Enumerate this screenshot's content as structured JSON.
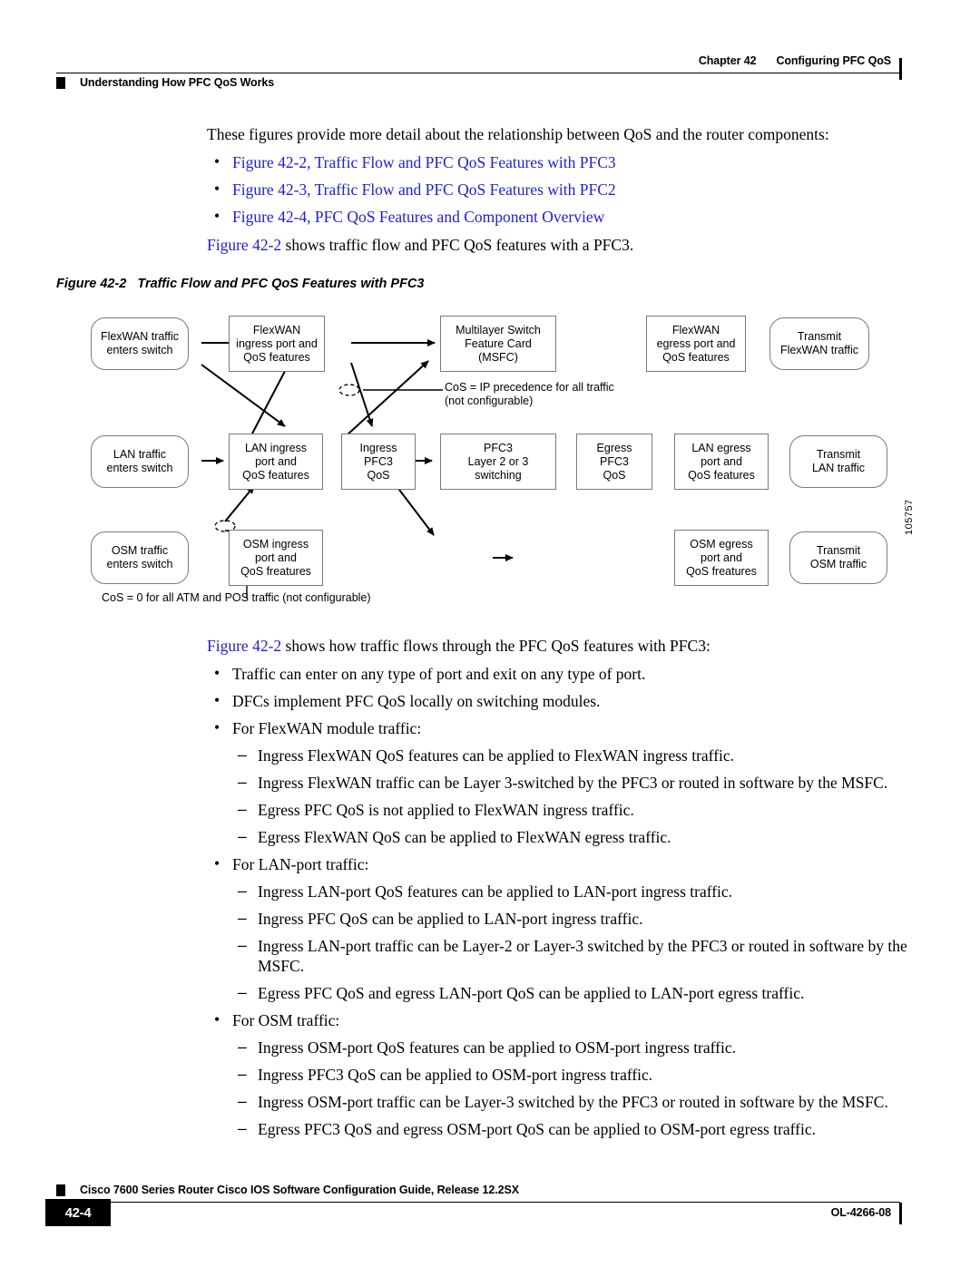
{
  "header": {
    "chapter": "Chapter 42",
    "chapter_title": "Configuring PFC QoS",
    "section": "Understanding How PFC QoS Works"
  },
  "intro": {
    "lead": "These figures provide more detail about the relationship between QoS and the router components:",
    "links": [
      "Figure 42-2, Traffic Flow and PFC QoS Features with PFC3",
      "Figure 42-3, Traffic Flow and PFC QoS Features with PFC2",
      "Figure 42-4, PFC QoS Features and Component Overview"
    ],
    "after_link_ref": "Figure 42-2",
    "after_link_rest": " shows traffic flow and PFC QoS features with a PFC3."
  },
  "figure": {
    "number": "Figure 42-2",
    "title": "Traffic Flow and PFC QoS Features with PFC3",
    "id": "105757",
    "nodes": {
      "flexwan_in": "FlexWAN traffic\nenters switch",
      "flexwan_ingress": "FlexWAN\ningress port and\nQoS features",
      "msfc": "Multilayer Switch\nFeature Card\n(MSFC)",
      "flexwan_egress": "FlexWAN\negress port and\nQoS features",
      "flexwan_out": "Transmit\nFlexWAN traffic",
      "lan_in": "LAN traffic\nenters switch",
      "lan_ingress": "LAN ingress\nport and\nQoS features",
      "ingress_pfc3": "Ingress\nPFC3\nQoS",
      "pfc3_switching": "PFC3\nLayer 2 or 3\nswitching",
      "egress_pfc3": "Egress\nPFC3\nQoS",
      "lan_egress": "LAN egress\nport and\nQoS features",
      "lan_out": "Transmit\nLAN traffic",
      "osm_in": "OSM traffic\nenters switch",
      "osm_ingress": "OSM ingress\nport and\nQoS freatures",
      "osm_egress": "OSM egress\nport and\nQoS freatures",
      "osm_out": "Transmit\nOSM traffic"
    },
    "notes": {
      "cos_ip_precedence": "CoS = IP precedence for all traffic\n(not configurable)",
      "cos_zero": "CoS = 0 for all ATM and POS traffic (not configurable)"
    }
  },
  "body": {
    "lead_ref": "Figure 42-2",
    "lead_rest": " shows how traffic flows through the PFC QoS features with PFC3:",
    "items": [
      {
        "level": "bullet",
        "text": "Traffic can enter on any type of port and exit on any type of port."
      },
      {
        "level": "bullet",
        "text": "DFCs implement PFC QoS locally on switching modules."
      },
      {
        "level": "bullet",
        "text": "For FlexWAN module traffic:"
      },
      {
        "level": "dash",
        "text": "Ingress FlexWAN QoS features can be applied to FlexWAN ingress traffic."
      },
      {
        "level": "dash",
        "text": "Ingress FlexWAN traffic can be Layer 3-switched by the PFC3 or routed in software by the MSFC."
      },
      {
        "level": "dash",
        "text": "Egress PFC QoS is not applied to FlexWAN ingress traffic."
      },
      {
        "level": "dash",
        "text": "Egress FlexWAN QoS can be applied to FlexWAN egress traffic."
      },
      {
        "level": "bullet",
        "text": "For LAN-port traffic:"
      },
      {
        "level": "dash",
        "text": "Ingress LAN-port QoS features can be applied to LAN-port ingress traffic."
      },
      {
        "level": "dash",
        "text": "Ingress PFC QoS can be applied to LAN-port ingress traffic."
      },
      {
        "level": "dash",
        "text": "Ingress LAN-port traffic can be Layer-2 or Layer-3 switched by the PFC3 or routed in software by the MSFC."
      },
      {
        "level": "dash",
        "text": "Egress PFC QoS and egress LAN-port QoS can be applied to LAN-port egress traffic."
      },
      {
        "level": "bullet",
        "text": "For OSM traffic:"
      },
      {
        "level": "dash",
        "text": "Ingress OSM-port QoS features can be applied to OSM-port ingress traffic."
      },
      {
        "level": "dash",
        "text": "Ingress PFC3 QoS can be applied to OSM-port ingress traffic."
      },
      {
        "level": "dash",
        "text": "Ingress OSM-port traffic can be Layer-3 switched by the PFC3 or routed in software by the MSFC."
      },
      {
        "level": "dash",
        "text": "Egress PFC3 QoS and egress OSM-port QoS can be applied to OSM-port egress traffic."
      }
    ]
  },
  "footer": {
    "guide_title": "Cisco 7600 Series Router Cisco IOS Software Configuration Guide, Release 12.2SX",
    "page_number": "42-4",
    "doc_number": "OL-4266-08"
  },
  "colors": {
    "link": "#2020d0",
    "box_border": "#7a7a7a",
    "ink": "#000000"
  }
}
